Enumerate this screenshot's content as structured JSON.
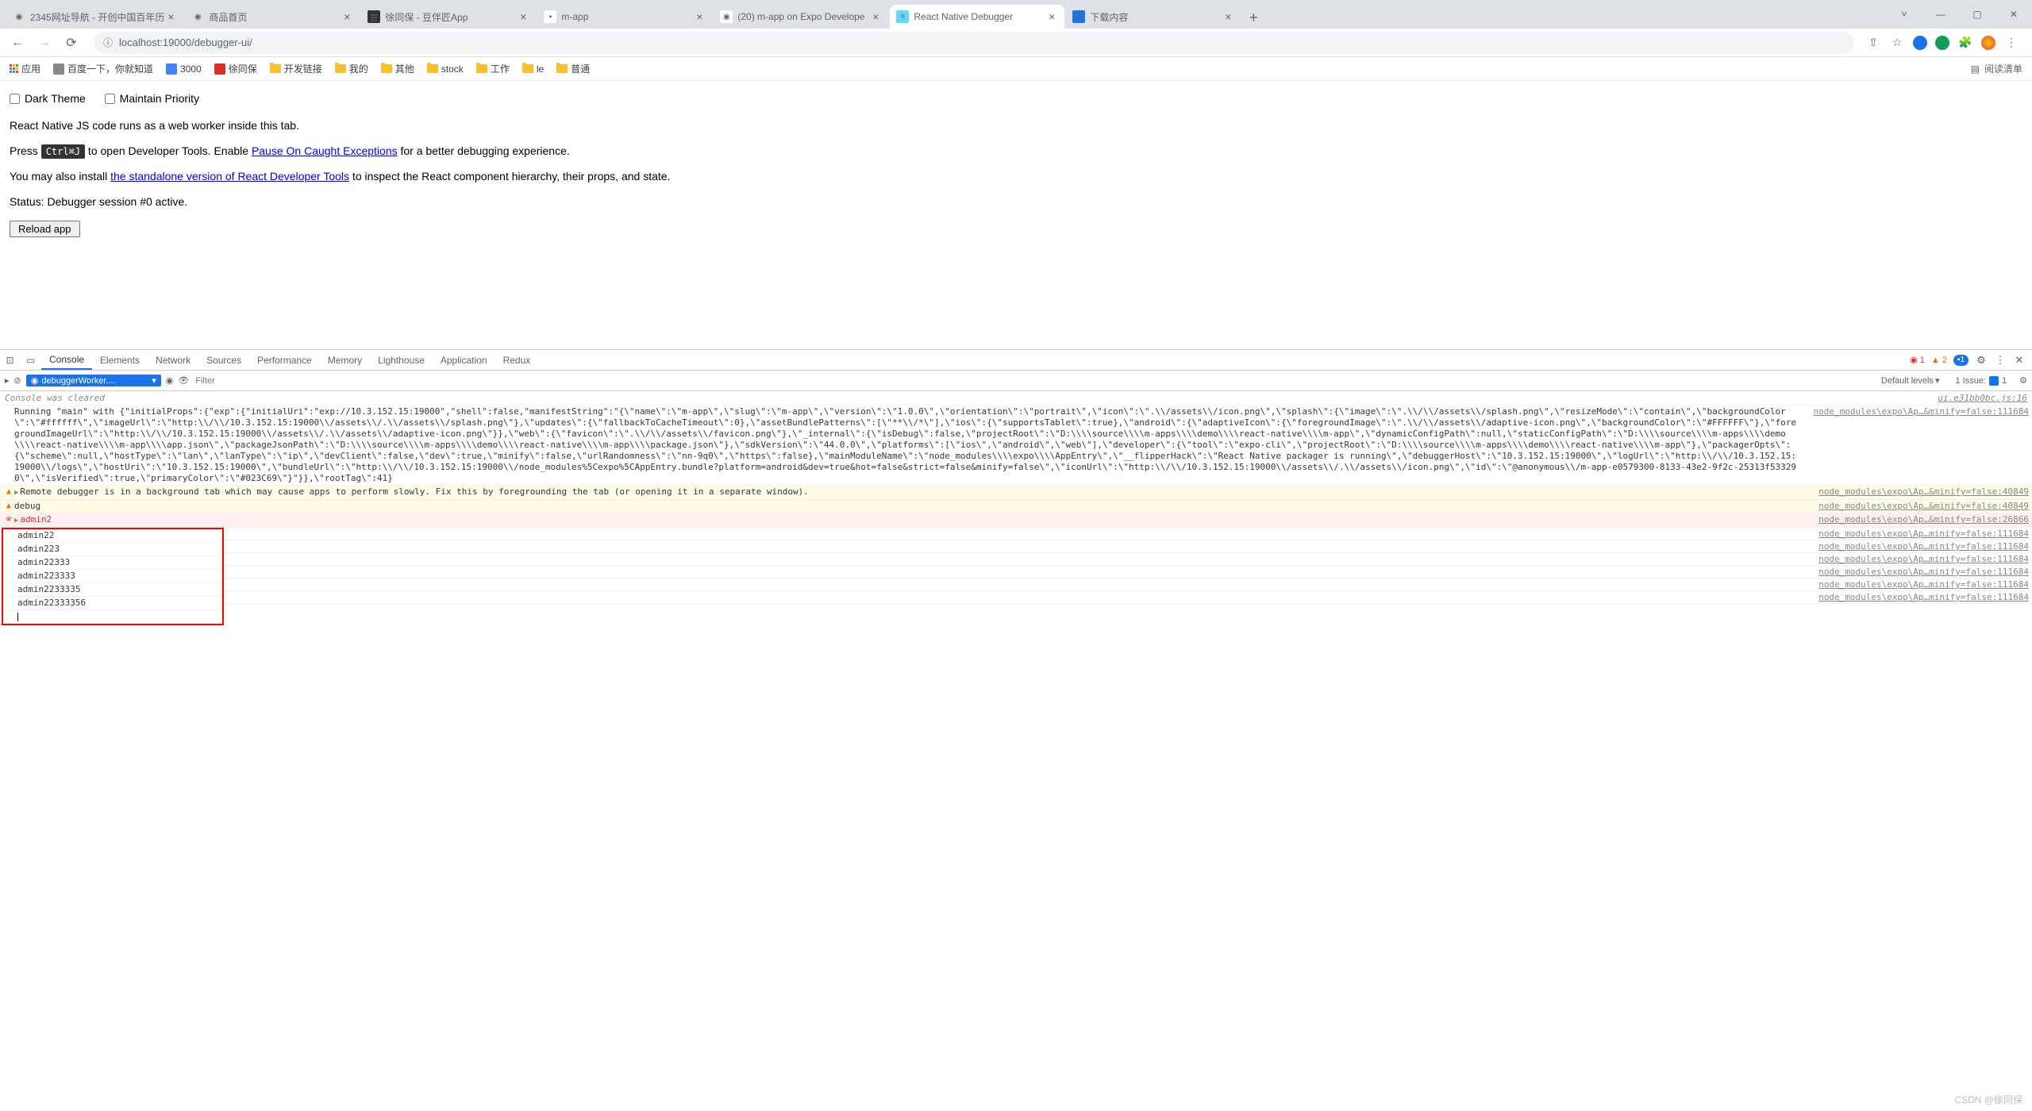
{
  "browser": {
    "tabs": [
      {
        "title": "2345网址导航 - 开创中国百年历",
        "icon_bg": "#e0e0e0",
        "icon_txt": "◉"
      },
      {
        "title": "商品首页",
        "icon_bg": "#e0e0e0",
        "icon_txt": "◉"
      },
      {
        "title": "徐同保 - 豆伴匠App",
        "icon_bg": "#333",
        "icon_txt": "豆"
      },
      {
        "title": "m-app",
        "icon_bg": "#fff",
        "icon_txt": "▪"
      },
      {
        "title": "(20) m-app on Expo Develope",
        "icon_bg": "#fff",
        "icon_txt": "◉"
      },
      {
        "title": "React Native Debugger",
        "icon_bg": "#61dafb",
        "icon_txt": "⚛"
      },
      {
        "title": "下载内容",
        "icon_bg": "#1a73e8",
        "icon_txt": "⬇"
      }
    ],
    "active_tab": 5,
    "url": "localhost:19000/debugger-ui/",
    "bookmarks": {
      "apps_label": "应用",
      "items": [
        {
          "label": "百度一下，你就知道",
          "type": "link"
        },
        {
          "label": "3000",
          "type": "link",
          "color": "#4285f4"
        },
        {
          "label": "徐同保",
          "type": "link",
          "color": "#d93025"
        },
        {
          "label": "开发链接",
          "type": "folder"
        },
        {
          "label": "我的",
          "type": "folder"
        },
        {
          "label": "其他",
          "type": "folder"
        },
        {
          "label": "stock",
          "type": "folder"
        },
        {
          "label": "工作",
          "type": "folder"
        },
        {
          "label": "le",
          "type": "folder"
        },
        {
          "label": "普通",
          "type": "folder"
        }
      ],
      "reading_list": "阅读清单"
    }
  },
  "page": {
    "dark_theme_label": "Dark Theme",
    "maintain_priority_label": "Maintain Priority",
    "intro": "React Native JS code runs as a web worker inside this tab.",
    "press": "Press ",
    "kbd": "Ctrl⌘J",
    "open_tools": " to open Developer Tools. Enable ",
    "pause_link": "Pause On Caught Exceptions",
    "better": " for a better debugging experience.",
    "also": "You may also install ",
    "standalone_link": "the standalone version of React Developer Tools",
    "inspect": " to inspect the React component hierarchy, their props, and state.",
    "status": "Status: Debugger session #0 active.",
    "reload_btn": "Reload app"
  },
  "devtools": {
    "tabs": [
      "Console",
      "Elements",
      "Network",
      "Sources",
      "Performance",
      "Memory",
      "Lighthouse",
      "Application",
      "Redux"
    ],
    "active_tab": 0,
    "err_count": "1",
    "warn_count": "2",
    "info_count": "1",
    "context": "debuggerWorker....",
    "filter_placeholder": "Filter",
    "levels": "Default levels",
    "issues_label": "1 Issue:",
    "issues_count": "1",
    "cleared": "Console was cleared",
    "cleared_src": "ui.e31bb0bc.js:16",
    "running_text": "Running \"main\" with {\"initialProps\":{\"exp\":{\"initialUri\":\"exp://10.3.152.15:19000\",\"shell\":false,\"manifestString\":\"{\\\"name\\\":\\\"m-app\\\",\\\"slug\\\":\\\"m-app\\\",\\\"version\\\":\\\"1.0.0\\\",\\\"orientation\\\":\\\"portrait\\\",\\\"icon\\\":\\\".\\\\/assets\\\\/icon.png\\\",\\\"splash\\\":{\\\"image\\\":\\\".\\\\/\\\\/assets\\\\/splash.png\\\",\\\"resizeMode\\\":\\\"contain\\\",\\\"backgroundColor\\\":\\\"#ffffff\\\",\\\"imageUrl\\\":\\\"http:\\\\/\\\\/10.3.152.15:19000\\\\/assets\\\\/.\\\\/assets\\\\/splash.png\\\"},\\\"updates\\\":{\\\"fallbackToCacheTimeout\\\":0},\\\"assetBundlePatterns\\\":[\\\"**\\\\/*\\\"],\\\"ios\\\":{\\\"supportsTablet\\\":true},\\\"android\\\":{\\\"adaptiveIcon\\\":{\\\"foregroundImage\\\":\\\".\\\\/\\\\/assets\\\\/adaptive-icon.png\\\",\\\"backgroundColor\\\":\\\"#FFFFFF\\\"},\\\"foregroundImageUrl\\\":\\\"http:\\\\/\\\\/10.3.152.15:19000\\\\/assets\\\\/.\\\\/assets\\\\/adaptive-icon.png\\\"}},\\\"web\\\":{\\\"favicon\\\":\\\".\\\\/\\\\/assets\\\\/favicon.png\\\"},\\\"_internal\\\":{\\\"isDebug\\\":false,\\\"projectRoot\\\":\\\"D:\\\\\\\\source\\\\\\\\m-apps\\\\\\\\demo\\\\\\\\react-native\\\\\\\\m-app\\\",\\\"dynamicConfigPath\\\":null,\\\"staticConfigPath\\\":\\\"D:\\\\\\\\source\\\\\\\\m-apps\\\\\\\\demo\\\\\\\\react-native\\\\\\\\m-app\\\\\\\\app.json\\\",\\\"packageJsonPath\\\":\\\"D:\\\\\\\\source\\\\\\\\m-apps\\\\\\\\demo\\\\\\\\react-native\\\\\\\\m-app\\\\\\\\package.json\\\"},\\\"sdkVersion\\\":\\\"44.0.0\\\",\\\"platforms\\\":[\\\"ios\\\",\\\"android\\\",\\\"web\\\"],\\\"developer\\\":{\\\"tool\\\":\\\"expo-cli\\\",\\\"projectRoot\\\":\\\"D:\\\\\\\\source\\\\\\\\m-apps\\\\\\\\demo\\\\\\\\react-native\\\\\\\\m-app\\\"},\\\"packagerOpts\\\":{\\\"scheme\\\":null,\\\"hostType\\\":\\\"lan\\\",\\\"lanType\\\":\\\"ip\\\",\\\"devClient\\\":false,\\\"dev\\\":true,\\\"minify\\\":false,\\\"urlRandomness\\\":\\\"nn-9q0\\\",\\\"https\\\":false},\\\"mainModuleName\\\":\\\"node_modules\\\\\\\\expo\\\\\\\\AppEntry\\\",\\\"__flipperHack\\\":\\\"React Native packager is running\\\",\\\"debuggerHost\\\":\\\"10.3.152.15:19000\\\",\\\"logUrl\\\":\\\"http:\\\\/\\\\/10.3.152.15:19000\\\\/logs\\\",\\\"hostUri\\\":\\\"10.3.152.15:19000\\\",\\\"bundleUrl\\\":\\\"http:\\\\/\\\\/10.3.152.15:19000\\\\/node_modules%5Cexpo%5CAppEntry.bundle?platform=android&dev=true&hot=false&strict=false&minify=false\\\",\\\"iconUrl\\\":\\\"http:\\\\/\\\\/10.3.152.15:19000\\\\/assets\\\\/.\\\\/assets\\\\/icon.png\\\",\\\"id\\\":\\\"@anonymous\\\\/m-app-e0579300-8133-43e2-9f2c-25313f533290\\\",\\\"isVerified\\\":true,\\\"primaryColor\\\":\\\"#023C69\\\"}\"}},\\\"rootTag\\\":41}",
    "running_src": "node_modules\\expo\\Ap…&minify=false:111684",
    "warn_msg": "Remote debugger is in a background tab which may cause apps to perform slowly. Fix this by foregrounding the tab (or opening it in a separate window).",
    "warn_src": "node_modules\\expo\\Ap…&minify=false:40849",
    "debug_msg": "debug",
    "debug_src": "node_modules\\expo\\Ap…&minify=false:40849",
    "err_msg": "admin2",
    "err_src": "node_modules\\expo\\Ap…&minify=false:26866",
    "logs": [
      {
        "msg": "admin22",
        "src": "node_modules\\expo\\Ap…minify=false:111684"
      },
      {
        "msg": "admin223",
        "src": "node_modules\\expo\\Ap…minify=false:111684"
      },
      {
        "msg": "admin22333",
        "src": "node_modules\\expo\\Ap…minify=false:111684"
      },
      {
        "msg": "admin223333",
        "src": "node_modules\\expo\\Ap…minify=false:111684"
      },
      {
        "msg": "admin2233335",
        "src": "node_modules\\expo\\Ap…minify=false:111684"
      },
      {
        "msg": "admin22333356",
        "src": "node_modules\\expo\\Ap…minify=false:111684"
      }
    ]
  },
  "watermark": "CSDN @徐同保"
}
